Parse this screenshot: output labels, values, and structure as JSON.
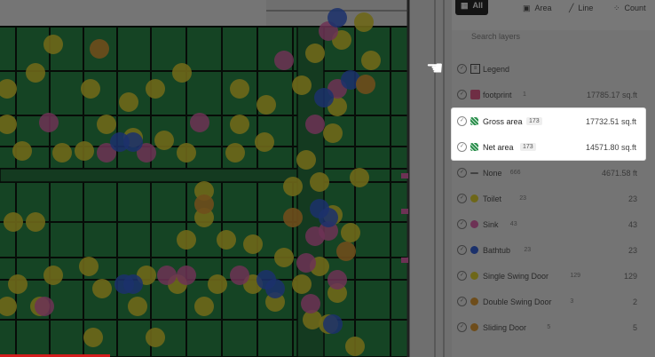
{
  "tabs": [
    {
      "label": "All",
      "icon": "grid-icon",
      "active": true
    },
    {
      "label": "Area",
      "icon": "area-icon",
      "active": false
    },
    {
      "label": "Line",
      "icon": "line-icon",
      "active": false
    },
    {
      "label": "Count",
      "icon": "count-icon",
      "active": false
    }
  ],
  "search": {
    "placeholder": "Search layers"
  },
  "layers": [
    {
      "name": "Legend",
      "count": "",
      "value": "",
      "kind": "legend"
    },
    {
      "name": "footprint",
      "count": "1",
      "value": "17785.17 sq.ft",
      "kind": "area",
      "color": "#e8608f"
    },
    {
      "name": "Gross area",
      "count": "173",
      "value": "17732.51 sq.ft",
      "kind": "area",
      "color": "#2c8f4d",
      "highlighted": true
    },
    {
      "name": "Net area",
      "count": "173",
      "value": "14571.80 sq.ft",
      "kind": "area",
      "color": "#2c8f4d",
      "highlighted": true
    },
    {
      "name": "None",
      "count": "666",
      "value": "4671.58 ft",
      "kind": "line",
      "color": "#888888"
    },
    {
      "name": "Toilet",
      "count": "23",
      "value": "23",
      "kind": "count",
      "color": "#e6d836"
    },
    {
      "name": "Sink",
      "count": "43",
      "value": "43",
      "kind": "count",
      "color": "#e46ab2"
    },
    {
      "name": "Bathtub",
      "count": "23",
      "value": "23",
      "kind": "count",
      "color": "#3a66e0"
    },
    {
      "name": "Single Swing Door",
      "count": "129",
      "value": "129",
      "kind": "count",
      "color": "#e6d836"
    },
    {
      "name": "Double Swing Door",
      "count": "3",
      "value": "2",
      "kind": "count",
      "color": "#e6a23a"
    },
    {
      "name": "Sliding Door",
      "count": "5",
      "value": "5",
      "kind": "count",
      "color": "#e6a23a"
    }
  ],
  "colors": {
    "room_fill": "#2c8f4d",
    "wall": "#0f1a12",
    "toilet": "#e6d836",
    "sink": "#e46ab2",
    "bathtub": "#3a66e0",
    "door": "#e6a23a",
    "highlight": "#ffffff"
  }
}
